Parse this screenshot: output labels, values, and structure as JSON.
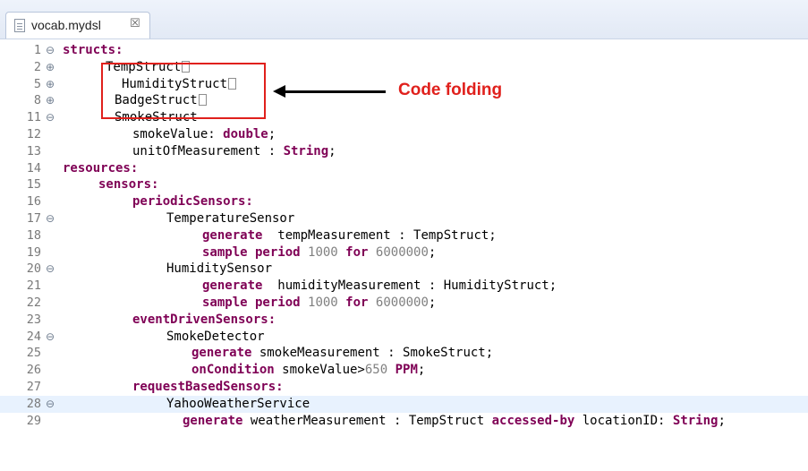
{
  "tab": {
    "title": "vocab.mydsl",
    "close_glyph": "☒"
  },
  "lines": [
    {
      "n": "1",
      "fold": "⊖",
      "indent": 70,
      "segs": [
        {
          "t": "structs:",
          "c": "kw"
        }
      ]
    },
    {
      "n": "2",
      "fold": "⊕",
      "indent": 118,
      "box": true,
      "segs": [
        {
          "t": "TempStruct"
        }
      ]
    },
    {
      "n": "5",
      "fold": "⊕",
      "indent": 136,
      "box": true,
      "segs": [
        {
          "t": "HumidityStruct"
        }
      ]
    },
    {
      "n": "8",
      "fold": "⊕",
      "indent": 128,
      "box": true,
      "segs": [
        {
          "t": "BadgeStruct"
        }
      ]
    },
    {
      "n": "11",
      "fold": "⊖",
      "indent": 128,
      "segs": [
        {
          "t": "SmokeStruct"
        }
      ]
    },
    {
      "n": "12",
      "fold": "",
      "indent": 148,
      "segs": [
        {
          "t": "smokeValue: "
        },
        {
          "t": "double",
          "c": "kw"
        },
        {
          "t": ";"
        }
      ]
    },
    {
      "n": "13",
      "fold": "",
      "indent": 148,
      "segs": [
        {
          "t": "unitOfMeasurement : "
        },
        {
          "t": "String",
          "c": "kw"
        },
        {
          "t": ";"
        }
      ]
    },
    {
      "n": "14",
      "fold": "",
      "indent": 70,
      "segs": [
        {
          "t": "resources:",
          "c": "kw"
        }
      ]
    },
    {
      "n": "15",
      "fold": "",
      "indent": 110,
      "segs": [
        {
          "t": "sensors:",
          "c": "kw"
        }
      ]
    },
    {
      "n": "16",
      "fold": "",
      "indent": 148,
      "segs": [
        {
          "t": "periodicSensors:",
          "c": "kw"
        }
      ]
    },
    {
      "n": "17",
      "fold": "⊖",
      "indent": 186,
      "segs": [
        {
          "t": "TemperatureSensor"
        }
      ]
    },
    {
      "n": "18",
      "fold": "",
      "indent": 226,
      "segs": [
        {
          "t": "generate",
          "c": "kw"
        },
        {
          "t": "  tempMeasurement : TempStruct;"
        }
      ]
    },
    {
      "n": "19",
      "fold": "",
      "indent": 226,
      "segs": [
        {
          "t": "sample period",
          "c": "kw"
        },
        {
          "t": " "
        },
        {
          "t": "1000",
          "c": "num"
        },
        {
          "t": " "
        },
        {
          "t": "for",
          "c": "kw"
        },
        {
          "t": " "
        },
        {
          "t": "6000000",
          "c": "num"
        },
        {
          "t": ";"
        }
      ]
    },
    {
      "n": "20",
      "fold": "⊖",
      "indent": 186,
      "segs": [
        {
          "t": "HumiditySensor"
        }
      ]
    },
    {
      "n": "21",
      "fold": "",
      "indent": 226,
      "segs": [
        {
          "t": "generate",
          "c": "kw"
        },
        {
          "t": "  humidityMeasurement : HumidityStruct;"
        }
      ]
    },
    {
      "n": "22",
      "fold": "",
      "indent": 226,
      "segs": [
        {
          "t": "sample period",
          "c": "kw"
        },
        {
          "t": " "
        },
        {
          "t": "1000",
          "c": "num"
        },
        {
          "t": " "
        },
        {
          "t": "for",
          "c": "kw"
        },
        {
          "t": " "
        },
        {
          "t": "6000000",
          "c": "num"
        },
        {
          "t": ";"
        }
      ]
    },
    {
      "n": "23",
      "fold": "",
      "indent": 148,
      "segs": [
        {
          "t": "eventDrivenSensors:",
          "c": "kw"
        }
      ]
    },
    {
      "n": "24",
      "fold": "⊖",
      "indent": 186,
      "segs": [
        {
          "t": "SmokeDetector"
        }
      ]
    },
    {
      "n": "25",
      "fold": "",
      "indent": 214,
      "segs": [
        {
          "t": "generate",
          "c": "kw"
        },
        {
          "t": " smokeMeasurement : SmokeStruct;"
        }
      ]
    },
    {
      "n": "26",
      "fold": "",
      "indent": 214,
      "segs": [
        {
          "t": "onCondition",
          "c": "kw"
        },
        {
          "t": " smokeValue>"
        },
        {
          "t": "650",
          "c": "num"
        },
        {
          "t": " "
        },
        {
          "t": "PPM",
          "c": "kw"
        },
        {
          "t": ";"
        }
      ]
    },
    {
      "n": "27",
      "fold": "",
      "indent": 148,
      "segs": [
        {
          "t": "requestBasedSensors:",
          "c": "kw"
        }
      ]
    },
    {
      "n": "28",
      "fold": "⊖",
      "indent": 186,
      "current": true,
      "segs": [
        {
          "t": "YahooWeatherService"
        }
      ]
    },
    {
      "n": "29",
      "fold": "",
      "indent": 204,
      "segs": [
        {
          "t": "generate",
          "c": "kw"
        },
        {
          "t": " weatherMeasurement : TempStruct "
        },
        {
          "t": "accessed-by",
          "c": "kw"
        },
        {
          "t": " locationID: "
        },
        {
          "t": "String",
          "c": "kw"
        },
        {
          "t": ";"
        }
      ]
    }
  ],
  "annotation": {
    "label": "Code folding",
    "color": "#e0201c"
  },
  "colors": {
    "keyword": "#7f0055",
    "number": "#808080",
    "line_number": "#7a7a7a",
    "current_line": "#e8f2fe"
  },
  "icons": {
    "tab_file": "file-icon",
    "tab_close": "close-icon",
    "fold_expanded": "minus-circle-icon",
    "fold_collapsed": "plus-circle-icon"
  }
}
